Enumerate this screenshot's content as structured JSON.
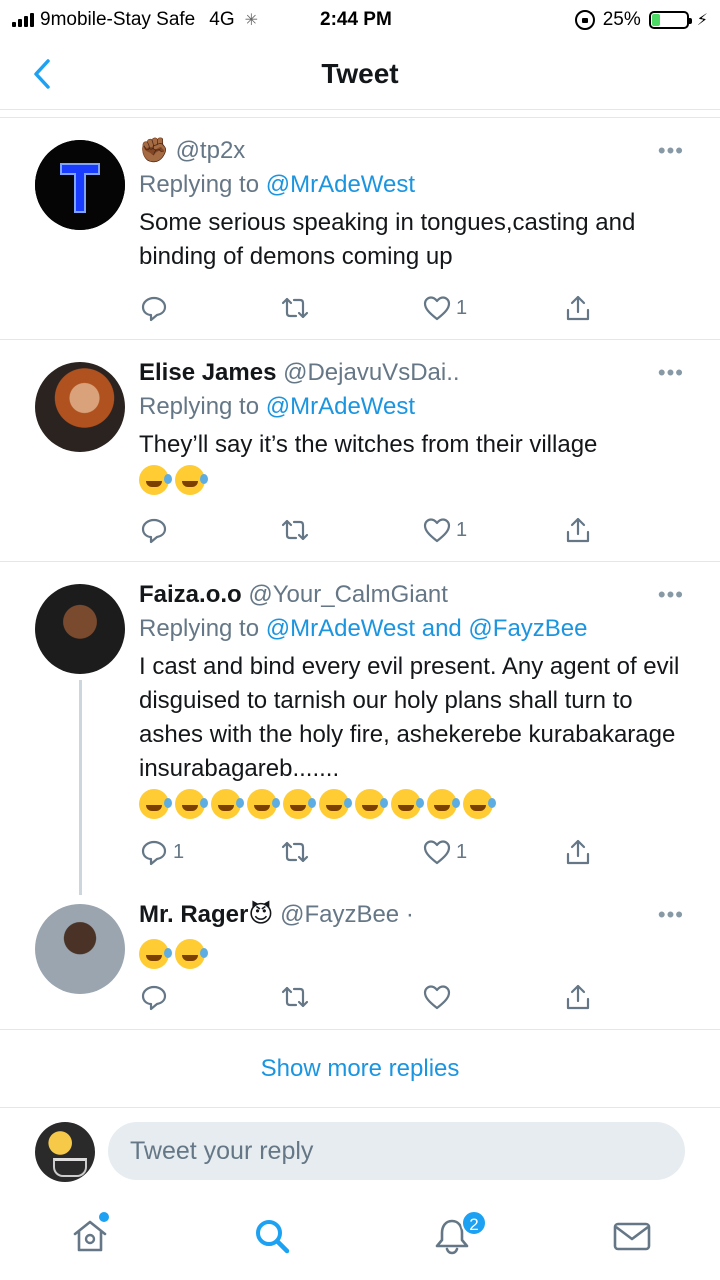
{
  "status_bar": {
    "carrier": "9mobile-Stay Safe",
    "network": "4G",
    "time": "2:44 PM",
    "battery_percent": "25%",
    "battery_level": 0.25
  },
  "header": {
    "title": "Tweet"
  },
  "tweets": [
    {
      "name": "",
      "name_emoji": "✊🏾",
      "handle": "@tp2x",
      "replying_prefix": "Replying to ",
      "replying_to": "@MrAdeWest",
      "replying_and": "",
      "text": "Some serious speaking in tongues,casting and binding of demons coming up",
      "emoji_count": 0,
      "replies": "",
      "likes": "1"
    },
    {
      "name": "Elise James",
      "handle": "@DejavuVsDai..",
      "replying_prefix": "Replying to ",
      "replying_to": "@MrAdeWest",
      "replying_and": "",
      "text": "They’ll say it’s the witches from their village",
      "emoji_count": 2,
      "replies": "",
      "likes": "1"
    },
    {
      "name": "Faiza.o.o",
      "handle": "@Your_CalmGiant",
      "replying_prefix": "Replying to ",
      "replying_to": "@MrAdeWest",
      "replying_and": " and @FayzBee",
      "text": "I cast and bind every evil present. Any agent of evil disguised to tarnish our holy plans shall turn to ashes with the holy fire, ashekerebe kurabakarage insurabagareb.......",
      "emoji_count": 10,
      "replies": "1",
      "likes": "1"
    },
    {
      "name": "Mr. Rager",
      "name_emoji": "😈",
      "handle": "@FayzBee ·",
      "emoji_count": 2,
      "replies": "",
      "likes": ""
    }
  ],
  "show_more": "Show more replies",
  "reply": {
    "placeholder": "Tweet your reply"
  },
  "tabbar": {
    "notifications_badge": "2"
  },
  "colors": {
    "accent": "#1da1f2",
    "link": "#1b95e0",
    "muted": "#657786"
  },
  "icons": [
    "back-chevron-icon",
    "reply-icon",
    "retweet-icon",
    "like-icon",
    "share-icon",
    "home-icon",
    "search-icon",
    "notifications-icon",
    "messages-icon"
  ]
}
